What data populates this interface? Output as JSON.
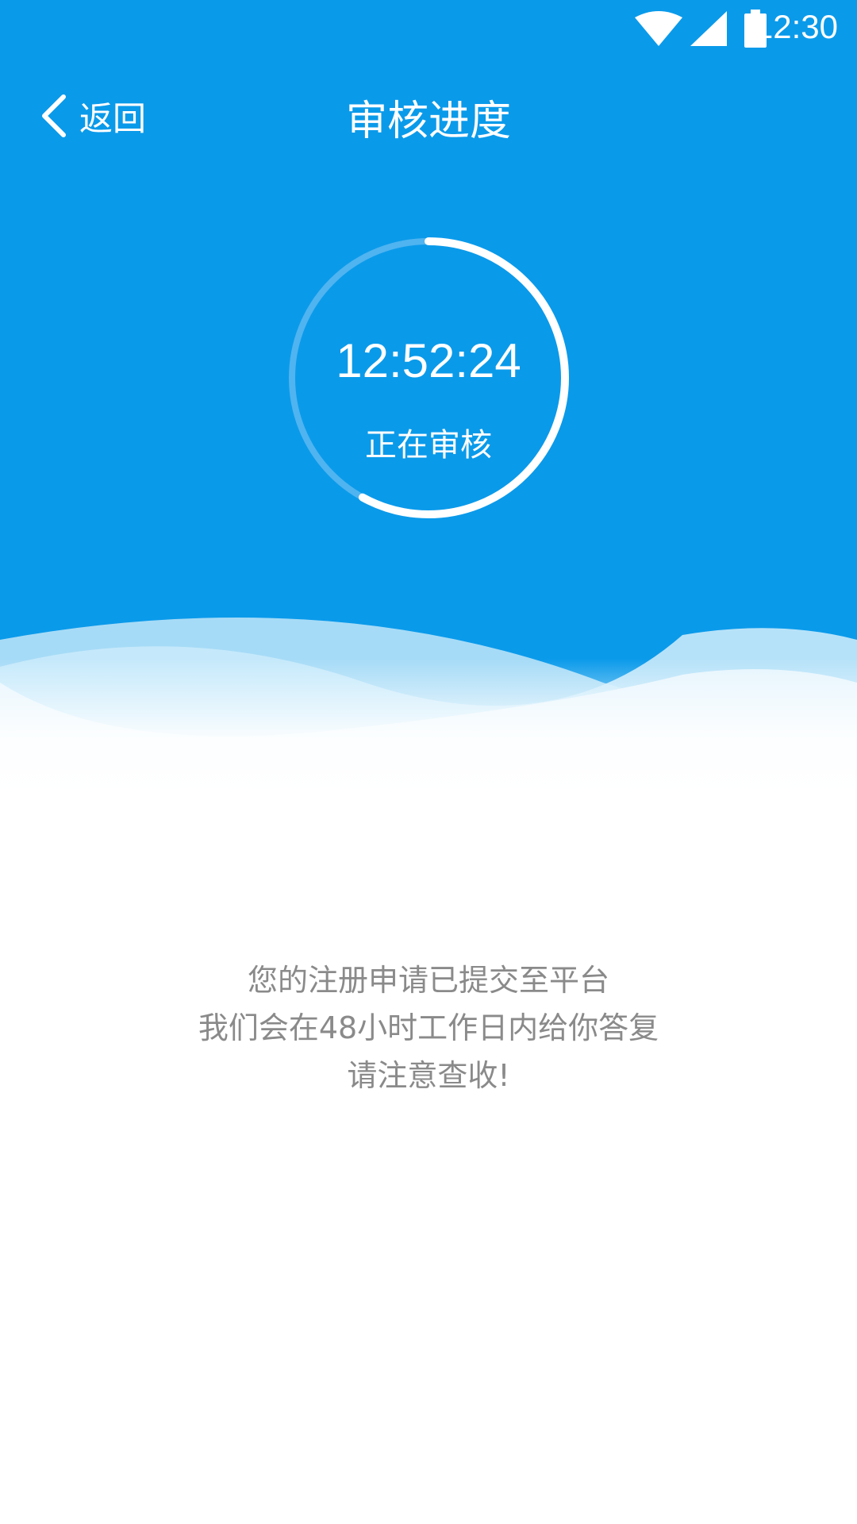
{
  "status_bar": {
    "time": "12:30",
    "icons": [
      "wifi-icon",
      "signal-icon",
      "battery-icon"
    ]
  },
  "nav": {
    "back_label": "返回",
    "title": "审核进度"
  },
  "review": {
    "timer": "12:52:24",
    "status": "正在审核",
    "progress_fraction": 0.58
  },
  "message": {
    "line1": "您的注册申请已提交至平台",
    "line2": "我们会在48小时工作日内给你答复",
    "line3": "请注意查收!"
  },
  "colors": {
    "primary": "#0a9aea",
    "text_light": "#ffffff",
    "text_gray": "#8a8a8a"
  }
}
